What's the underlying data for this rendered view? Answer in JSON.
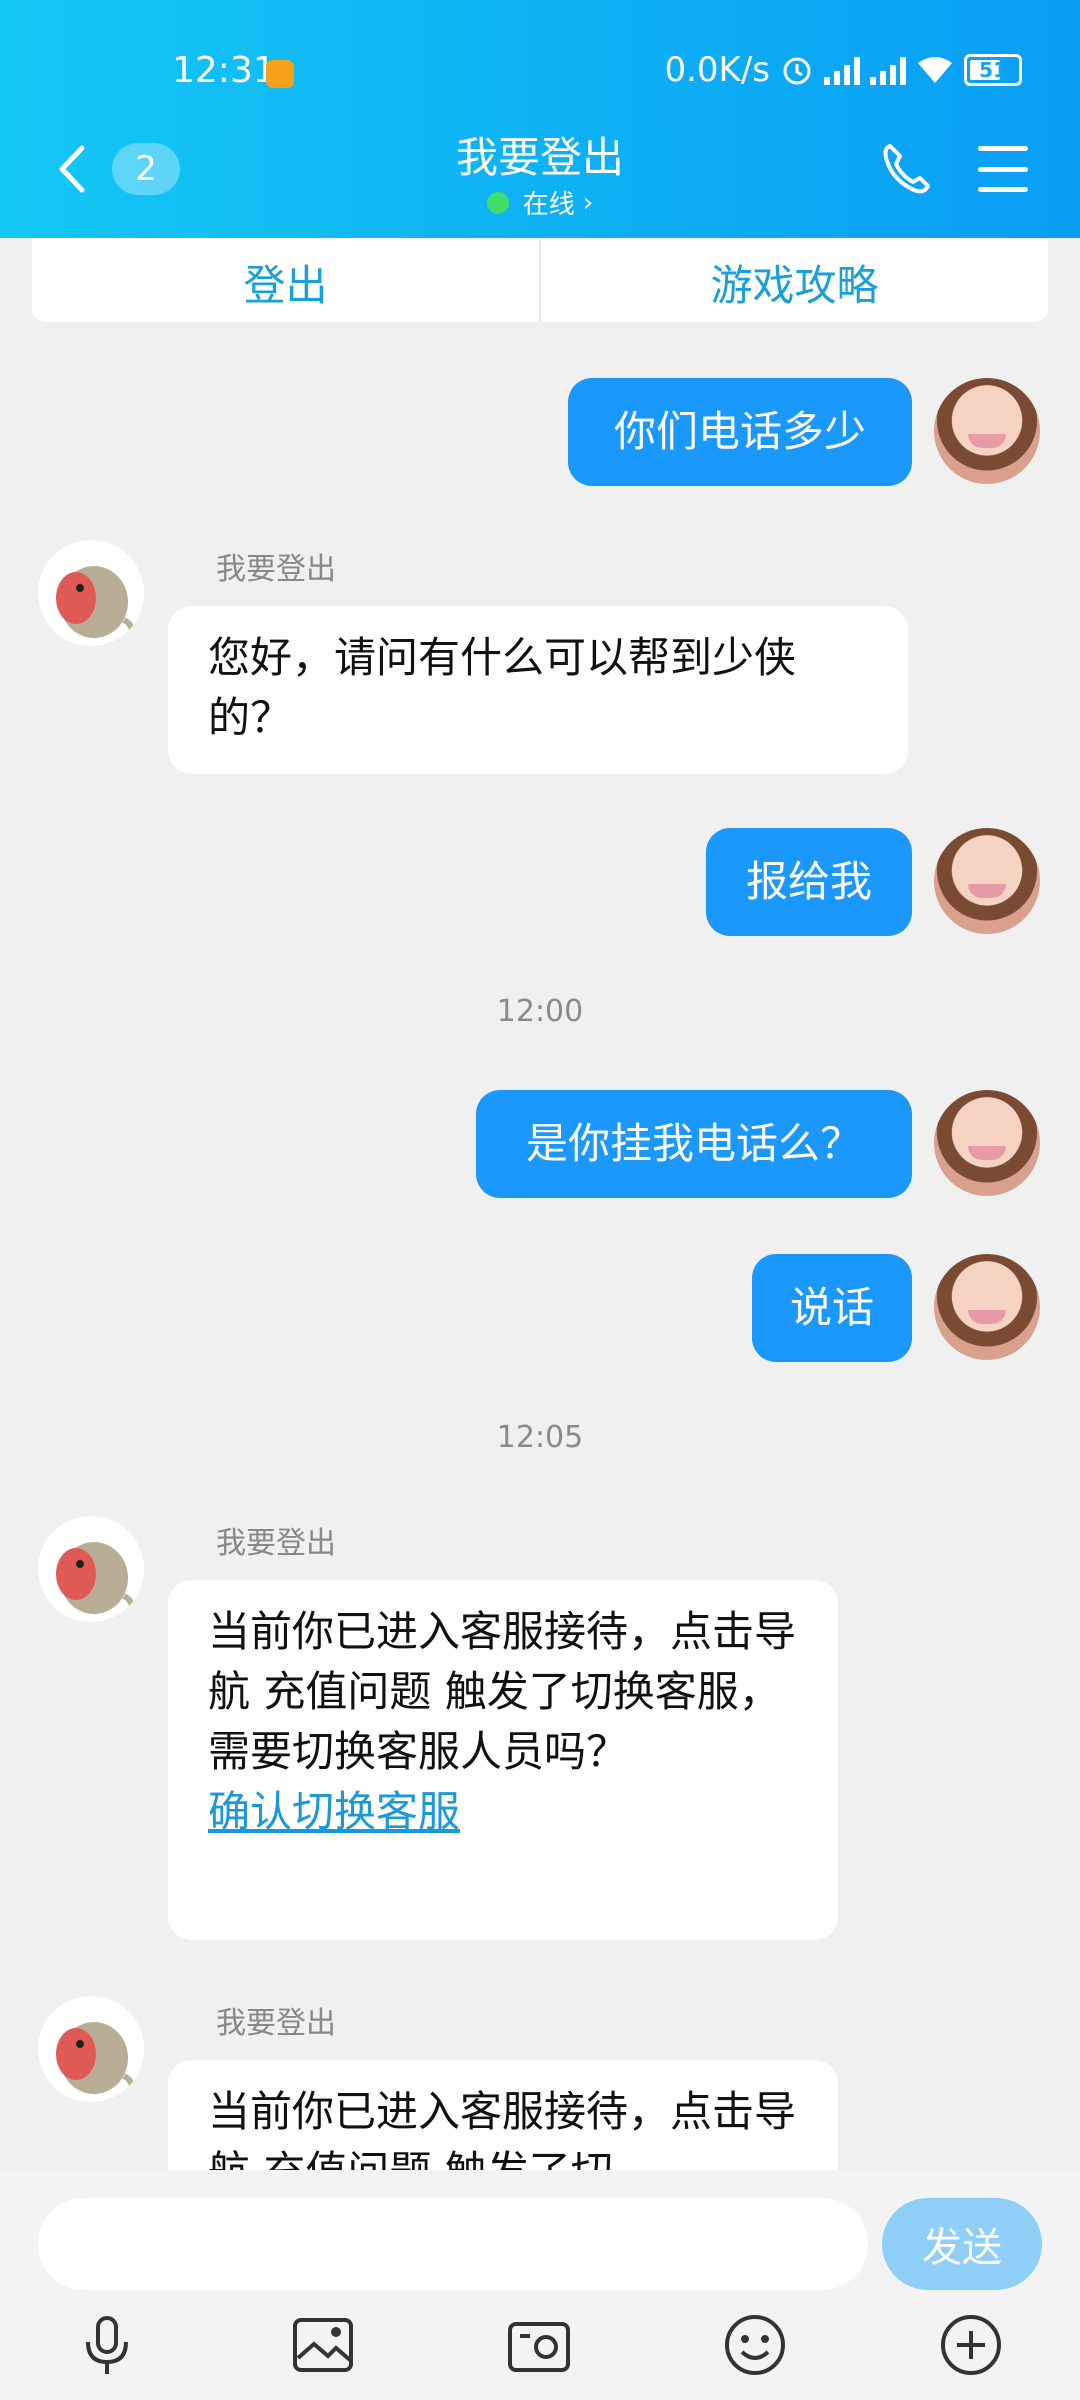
{
  "status_bar": {
    "time": "12:31",
    "net_speed": "0.0K/s",
    "battery": "51"
  },
  "header": {
    "unread_count": "2",
    "title": "我要登出",
    "status": "在线",
    "status_chevron": "›"
  },
  "quick_actions": [
    "登出",
    "游戏攻略"
  ],
  "messages": [
    {
      "kind": "out",
      "text": "你们电话多少"
    },
    {
      "kind": "in",
      "sender": "我要登出",
      "text": "您好，请问有什么可以帮到少侠的？"
    },
    {
      "kind": "out",
      "text": "报给我"
    },
    {
      "kind": "time",
      "text": "12:00"
    },
    {
      "kind": "out",
      "text": "是你挂我电话么？"
    },
    {
      "kind": "out",
      "text": "说话"
    },
    {
      "kind": "time",
      "text": "12:05"
    },
    {
      "kind": "in",
      "sender": "我要登出",
      "text": "当前你已进入客服接待，点击导航 充值问题 触发了切换客服，需要切换客服人员吗？",
      "link": "确认切换客服"
    },
    {
      "kind": "in",
      "sender": "我要登出",
      "text": "当前你已进入客服接待，点击导航 充值问题 触发了切"
    }
  ],
  "input": {
    "placeholder": "",
    "send_label": "发送"
  },
  "toolbar": [
    "microphone-icon",
    "photo-icon",
    "camera-icon",
    "emoji-icon",
    "plus-icon"
  ],
  "colors": {
    "header_start": "#14c8f5",
    "header_end": "#0a9ef5",
    "bubble_out": "#1a98fb",
    "link": "#1a98d8",
    "send_btn": "#8fcef7"
  }
}
